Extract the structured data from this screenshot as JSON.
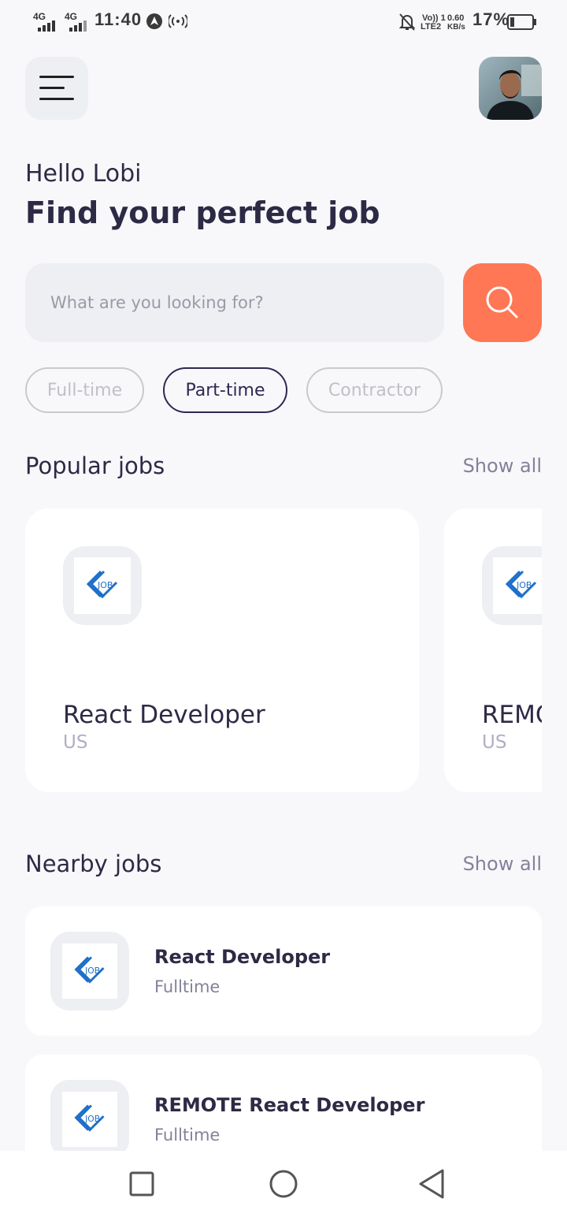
{
  "status_bar": {
    "network_1": "4G",
    "network_2": "4G",
    "time": "11:40",
    "volte_line1": "Vo)) 1",
    "volte_line2": "LTE2",
    "speed_value": "0.60",
    "speed_unit": "KB/s",
    "battery": "17%"
  },
  "header": {
    "greeting": "Hello Lobi",
    "headline": "Find your perfect job"
  },
  "search": {
    "placeholder": "What are you looking for?"
  },
  "job_types": [
    {
      "label": "Full-time",
      "active": false
    },
    {
      "label": "Part-time",
      "active": true
    },
    {
      "label": "Contractor",
      "active": false
    }
  ],
  "popular": {
    "title": "Popular jobs",
    "show_all": "Show all",
    "jobs": [
      {
        "logo_text": "JOB",
        "title": "React Developer",
        "country": "US"
      },
      {
        "logo_text": "JOB",
        "title": "REMOTE React Developer",
        "country": "US"
      }
    ]
  },
  "nearby": {
    "title": "Nearby jobs",
    "show_all": "Show all",
    "jobs": [
      {
        "logo_text": "JOB",
        "title": "React Developer",
        "type": "Fulltime"
      },
      {
        "logo_text": "JOB",
        "title": "REMOTE React Developer",
        "type": "Fulltime"
      }
    ]
  },
  "colors": {
    "background": "#F8F8FB",
    "primary": "#312651",
    "accent": "#FF7754",
    "gray": "#83829A",
    "logo_blue": "#1F6FC9"
  },
  "icons": {
    "menu": "menu-icon",
    "search": "search-icon",
    "company_logo": "job-logo-icon",
    "nav_recents": "square-icon",
    "nav_home": "circle-icon",
    "nav_back": "triangle-back-icon"
  }
}
